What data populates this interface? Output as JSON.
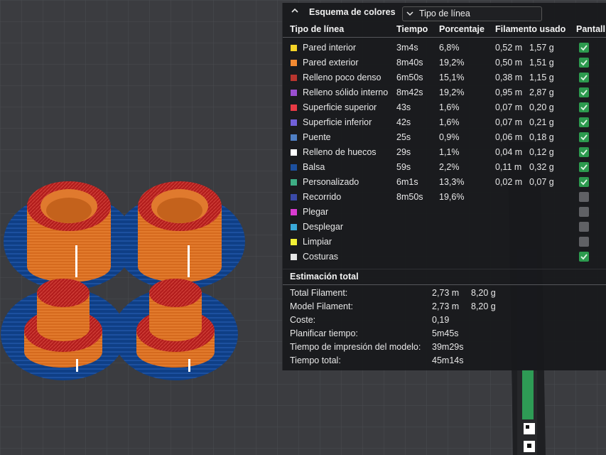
{
  "panel": {
    "title": "Esquema de colores",
    "view_selector": "Tipo de línea",
    "columns": {
      "type": "Tipo de línea",
      "time": "Tiempo",
      "percent": "Porcentaje",
      "filament": "Filamento usado",
      "display": "Pantall"
    },
    "rows": [
      {
        "label": "Pared interior",
        "time": "3m4s",
        "percent": "6,8%",
        "meters": "0,52 m",
        "grams": "1,57 g",
        "color": "#f5d327",
        "visible": true
      },
      {
        "label": "Pared exterior",
        "time": "8m40s",
        "percent": "19,2%",
        "meters": "0,50 m",
        "grams": "1,51 g",
        "color": "#f38a32",
        "visible": true
      },
      {
        "label": "Relleno poco denso",
        "time": "6m50s",
        "percent": "15,1%",
        "meters": "0,38 m",
        "grams": "1,15 g",
        "color": "#b8352e",
        "visible": true
      },
      {
        "label": "Relleno sólido interno",
        "time": "8m42s",
        "percent": "19,2%",
        "meters": "0,95 m",
        "grams": "2,87 g",
        "color": "#9a4fd0",
        "visible": true
      },
      {
        "label": "Superficie superior",
        "time": "43s",
        "percent": "1,6%",
        "meters": "0,07 m",
        "grams": "0,20 g",
        "color": "#e83a45",
        "visible": true
      },
      {
        "label": "Superficie inferior",
        "time": "42s",
        "percent": "1,6%",
        "meters": "0,07 m",
        "grams": "0,21 g",
        "color": "#7160d9",
        "visible": true
      },
      {
        "label": "Puente",
        "time": "25s",
        "percent": "0,9%",
        "meters": "0,06 m",
        "grams": "0,18 g",
        "color": "#4f7fc4",
        "visible": true
      },
      {
        "label": "Relleno de huecos",
        "time": "29s",
        "percent": "1,1%",
        "meters": "0,04 m",
        "grams": "0,12 g",
        "color": "#ffffff",
        "visible": true
      },
      {
        "label": "Balsa",
        "time": "59s",
        "percent": "2,2%",
        "meters": "0,11 m",
        "grams": "0,32 g",
        "color": "#1c4f9e",
        "visible": true
      },
      {
        "label": "Personalizado",
        "time": "6m1s",
        "percent": "13,3%",
        "meters": "0,02 m",
        "grams": "0,07 g",
        "color": "#3eae85",
        "visible": true
      },
      {
        "label": "Recorrido",
        "time": "8m50s",
        "percent": "19,6%",
        "meters": "",
        "grams": "",
        "color": "#3a4aa8",
        "visible": false
      },
      {
        "label": "Plegar",
        "time": "",
        "percent": "",
        "meters": "",
        "grams": "",
        "color": "#d93bd0",
        "visible": false
      },
      {
        "label": "Desplegar",
        "time": "",
        "percent": "",
        "meters": "",
        "grams": "",
        "color": "#3aa9d9",
        "visible": false
      },
      {
        "label": "Limpiar",
        "time": "",
        "percent": "",
        "meters": "",
        "grams": "",
        "color": "#f1f036",
        "visible": false
      },
      {
        "label": "Costuras",
        "time": "",
        "percent": "",
        "meters": "",
        "grams": "",
        "color": "#e6e6e6",
        "visible": true
      }
    ],
    "summary_title": "Estimación total",
    "summary": {
      "total_filament_label": "Total Filament:",
      "total_filament_m": "2,73 m",
      "total_filament_g": "8,20 g",
      "model_filament_label": "Model Filament:",
      "model_filament_m": "2,73 m",
      "model_filament_g": "8,20 g",
      "cost_label": "Coste:",
      "cost_value": "0,19",
      "plan_time_label": "Planificar tiempo:",
      "plan_time_value": "5m45s",
      "model_print_time_label": "Tiempo de impresión del modelo:",
      "model_print_time_value": "39m29s",
      "total_time_label": "Tiempo total:",
      "total_time_value": "45m14s"
    }
  },
  "colors": {
    "panel_bg": "#18191c",
    "check_on": "#2c9a4e",
    "check_off": "#606165",
    "bed": "#3b3c40",
    "raft": "#0f3f86",
    "part_orange": "#d9691c",
    "part_top_red": "#b41f1c"
  }
}
